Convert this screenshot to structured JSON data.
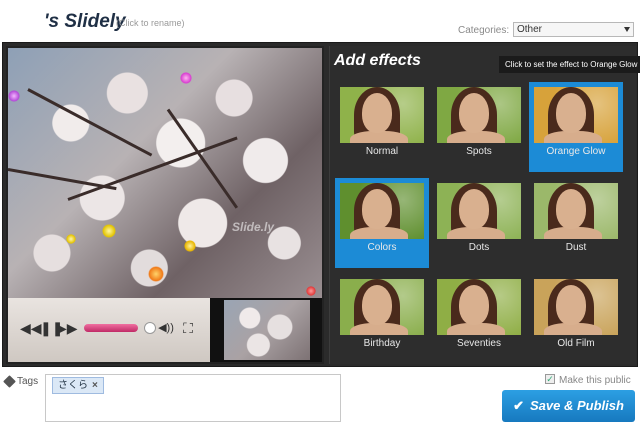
{
  "header": {
    "title": "'s Slidely",
    "rename_hint": "(Click to rename)",
    "categories_label": "Categories:",
    "category_value": "Other"
  },
  "player": {
    "watermark": "Slide.ly",
    "buttons": {
      "rewind": "◀◀",
      "pause": "❚❚",
      "forward": "▶▶",
      "volume": "◀))",
      "fullscreen": "⛶"
    },
    "progress": 0.75
  },
  "effects": {
    "title": "Add effects",
    "tooltip": "Click to set the effect to Orange Glow",
    "items": [
      {
        "label": "Normal",
        "selected": false,
        "tint": "#8fb24a"
      },
      {
        "label": "Spots",
        "selected": false,
        "tint": "#7fa843"
      },
      {
        "label": "Orange Glow",
        "selected": false,
        "highlight": true,
        "tint": "#d7a23a"
      },
      {
        "label": "Colors",
        "selected": true,
        "tint": "#5f8f2e"
      },
      {
        "label": "Dots",
        "selected": false,
        "tint": "#8db255"
      },
      {
        "label": "Dust",
        "selected": false,
        "tint": "#9bb86a"
      },
      {
        "label": "Birthday",
        "selected": false,
        "tint": "#8aae4c"
      },
      {
        "label": "Seventies",
        "selected": false,
        "tint": "#8fae45"
      },
      {
        "label": "Old Film",
        "selected": false,
        "tint": "#c9a35a"
      }
    ]
  },
  "tags": {
    "label": "Tags",
    "items": [
      {
        "text": "さくら",
        "remove": "×"
      }
    ]
  },
  "publish": {
    "make_public_label": "Make this public",
    "make_public_checked": true,
    "button_label": "Save & Publish",
    "check": "✔"
  }
}
